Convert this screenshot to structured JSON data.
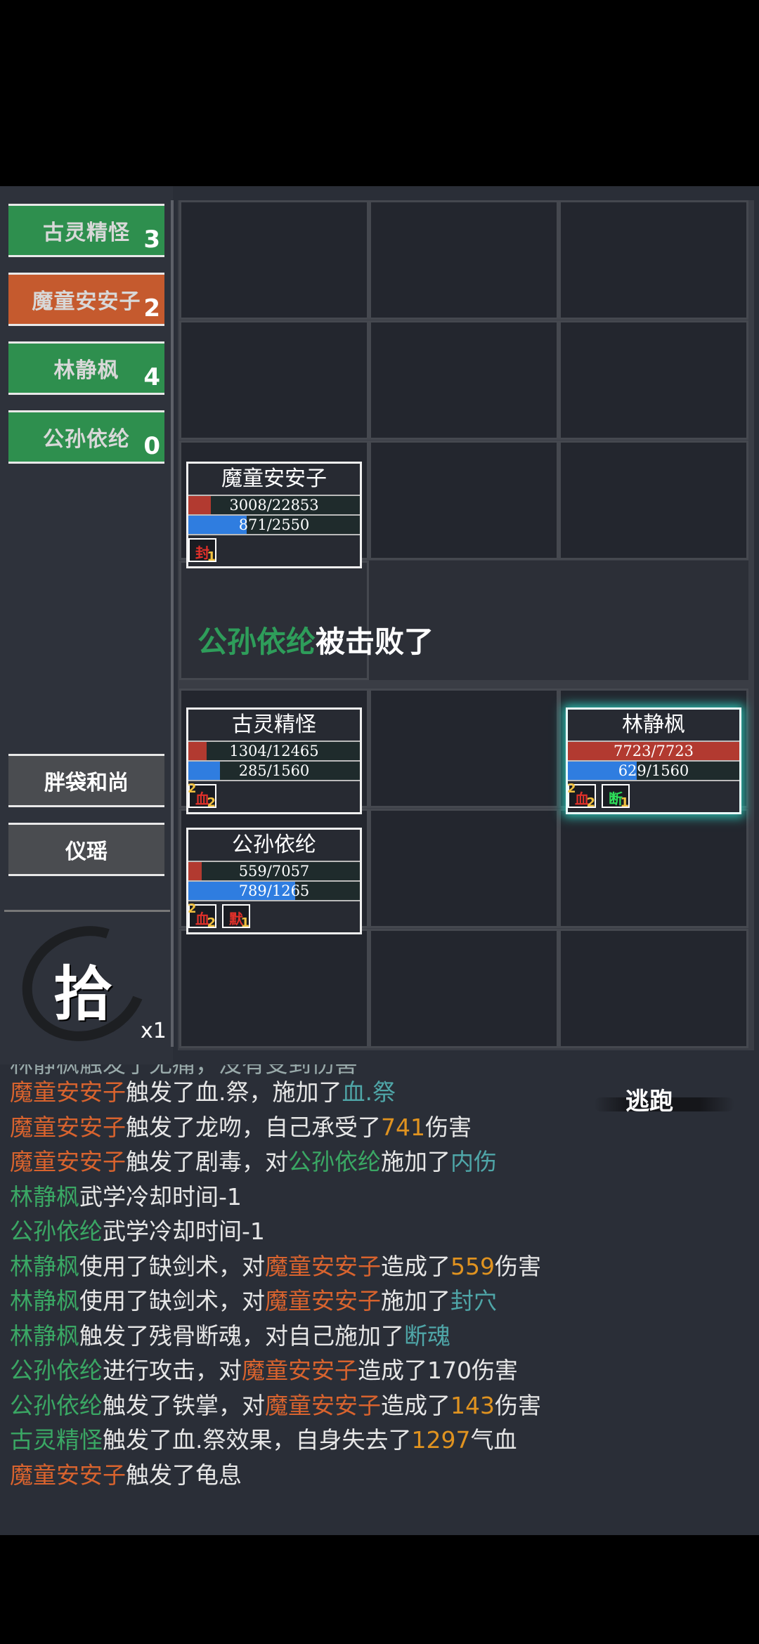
{
  "team": [
    {
      "name": "古灵精怪",
      "count": "3",
      "color": "green"
    },
    {
      "name": "魔童安安子",
      "count": "2",
      "color": "orange"
    },
    {
      "name": "林静枫",
      "count": "4",
      "color": "green"
    },
    {
      "name": "公孙依纶",
      "count": "0",
      "color": "green"
    }
  ],
  "reserve": [
    {
      "name": "胖袋和尚"
    },
    {
      "name": "仪瑶"
    }
  ],
  "seal": {
    "char": "拾",
    "multiplier": "x1"
  },
  "units": {
    "enemy": {
      "name": "魔童安安子",
      "hp_text": "3008/22853",
      "hp_fraction": 0.132,
      "mp_text": "871/2550",
      "mp_fraction": 0.342,
      "status": [
        {
          "glyph": "封",
          "stack": "1"
        }
      ]
    },
    "ally1": {
      "name": "古灵精怪",
      "hp_text": "1304/12465",
      "hp_fraction": 0.105,
      "mp_text": "285/1560",
      "mp_fraction": 0.183,
      "status": [
        {
          "glyph": "血",
          "stack_l": "2",
          "stack": "2"
        }
      ]
    },
    "ally2": {
      "name": "林静枫",
      "hp_text": "7723/7723",
      "hp_fraction": 1.0,
      "mp_text": "629/1560",
      "mp_fraction": 0.403,
      "status": [
        {
          "glyph": "血",
          "stack_l": "2",
          "stack": "2"
        },
        {
          "glyph": "断",
          "stack": "1"
        }
      ]
    },
    "ally3": {
      "name": "公孙依纶",
      "hp_text": "559/7057",
      "hp_fraction": 0.079,
      "mp_text": "789/1265",
      "mp_fraction": 0.624,
      "status": [
        {
          "glyph": "血",
          "stack_l": "2",
          "stack": "2"
        },
        {
          "glyph": "默",
          "stack": "1"
        }
      ]
    }
  },
  "defeat": {
    "name": "公孙依纶",
    "text": "被击败了"
  },
  "flee_label": "逃跑",
  "log_partial": "林静枫触发了无痛，没有受到伤害",
  "log": [
    [
      {
        "t": "魔童安安子",
        "c": "orange"
      },
      {
        "t": "触发了血.祭，施加了"
      },
      {
        "t": "血.祭",
        "c": "teal"
      }
    ],
    [
      {
        "t": "魔童安安子",
        "c": "orange"
      },
      {
        "t": "触发了龙吻，自己承受了"
      },
      {
        "t": "741",
        "c": "gold"
      },
      {
        "t": "伤害"
      }
    ],
    [
      {
        "t": "魔童安安子",
        "c": "orange"
      },
      {
        "t": "触发了剧毒，对"
      },
      {
        "t": "公孙依纶",
        "c": "green"
      },
      {
        "t": "施加了"
      },
      {
        "t": "内伤",
        "c": "teal"
      }
    ],
    [
      {
        "t": "林静枫",
        "c": "green"
      },
      {
        "t": "武学冷却时间-1"
      }
    ],
    [
      {
        "t": "公孙依纶",
        "c": "green"
      },
      {
        "t": "武学冷却时间-1"
      }
    ],
    [
      {
        "t": "林静枫",
        "c": "green"
      },
      {
        "t": "使用了缺剑术，对"
      },
      {
        "t": "魔童安安子",
        "c": "orange"
      },
      {
        "t": "造成了"
      },
      {
        "t": "559",
        "c": "gold"
      },
      {
        "t": "伤害"
      }
    ],
    [
      {
        "t": "林静枫",
        "c": "green"
      },
      {
        "t": "使用了缺剑术，对"
      },
      {
        "t": "魔童安安子",
        "c": "orange"
      },
      {
        "t": "施加了"
      },
      {
        "t": "封穴",
        "c": "teal"
      }
    ],
    [
      {
        "t": "林静枫",
        "c": "green"
      },
      {
        "t": "触发了残骨断魂，对自己施加了"
      },
      {
        "t": "断魂",
        "c": "teal"
      }
    ],
    [
      {
        "t": "公孙依纶",
        "c": "green"
      },
      {
        "t": "进行攻击，对"
      },
      {
        "t": "魔童安安子",
        "c": "orange"
      },
      {
        "t": "造成了170伤害"
      }
    ],
    [
      {
        "t": "公孙依纶",
        "c": "green"
      },
      {
        "t": "触发了铁掌，对"
      },
      {
        "t": "魔童安安子",
        "c": "orange"
      },
      {
        "t": "造成了"
      },
      {
        "t": "143",
        "c": "gold"
      },
      {
        "t": "伤害"
      }
    ],
    [
      {
        "t": "古灵精怪",
        "c": "green"
      },
      {
        "t": "触发了血.祭效果，自身失去了"
      },
      {
        "t": "1297",
        "c": "gold"
      },
      {
        "t": "气血"
      }
    ],
    [
      {
        "t": "魔童安安子",
        "c": "orange"
      },
      {
        "t": "触发了龟息"
      }
    ]
  ]
}
